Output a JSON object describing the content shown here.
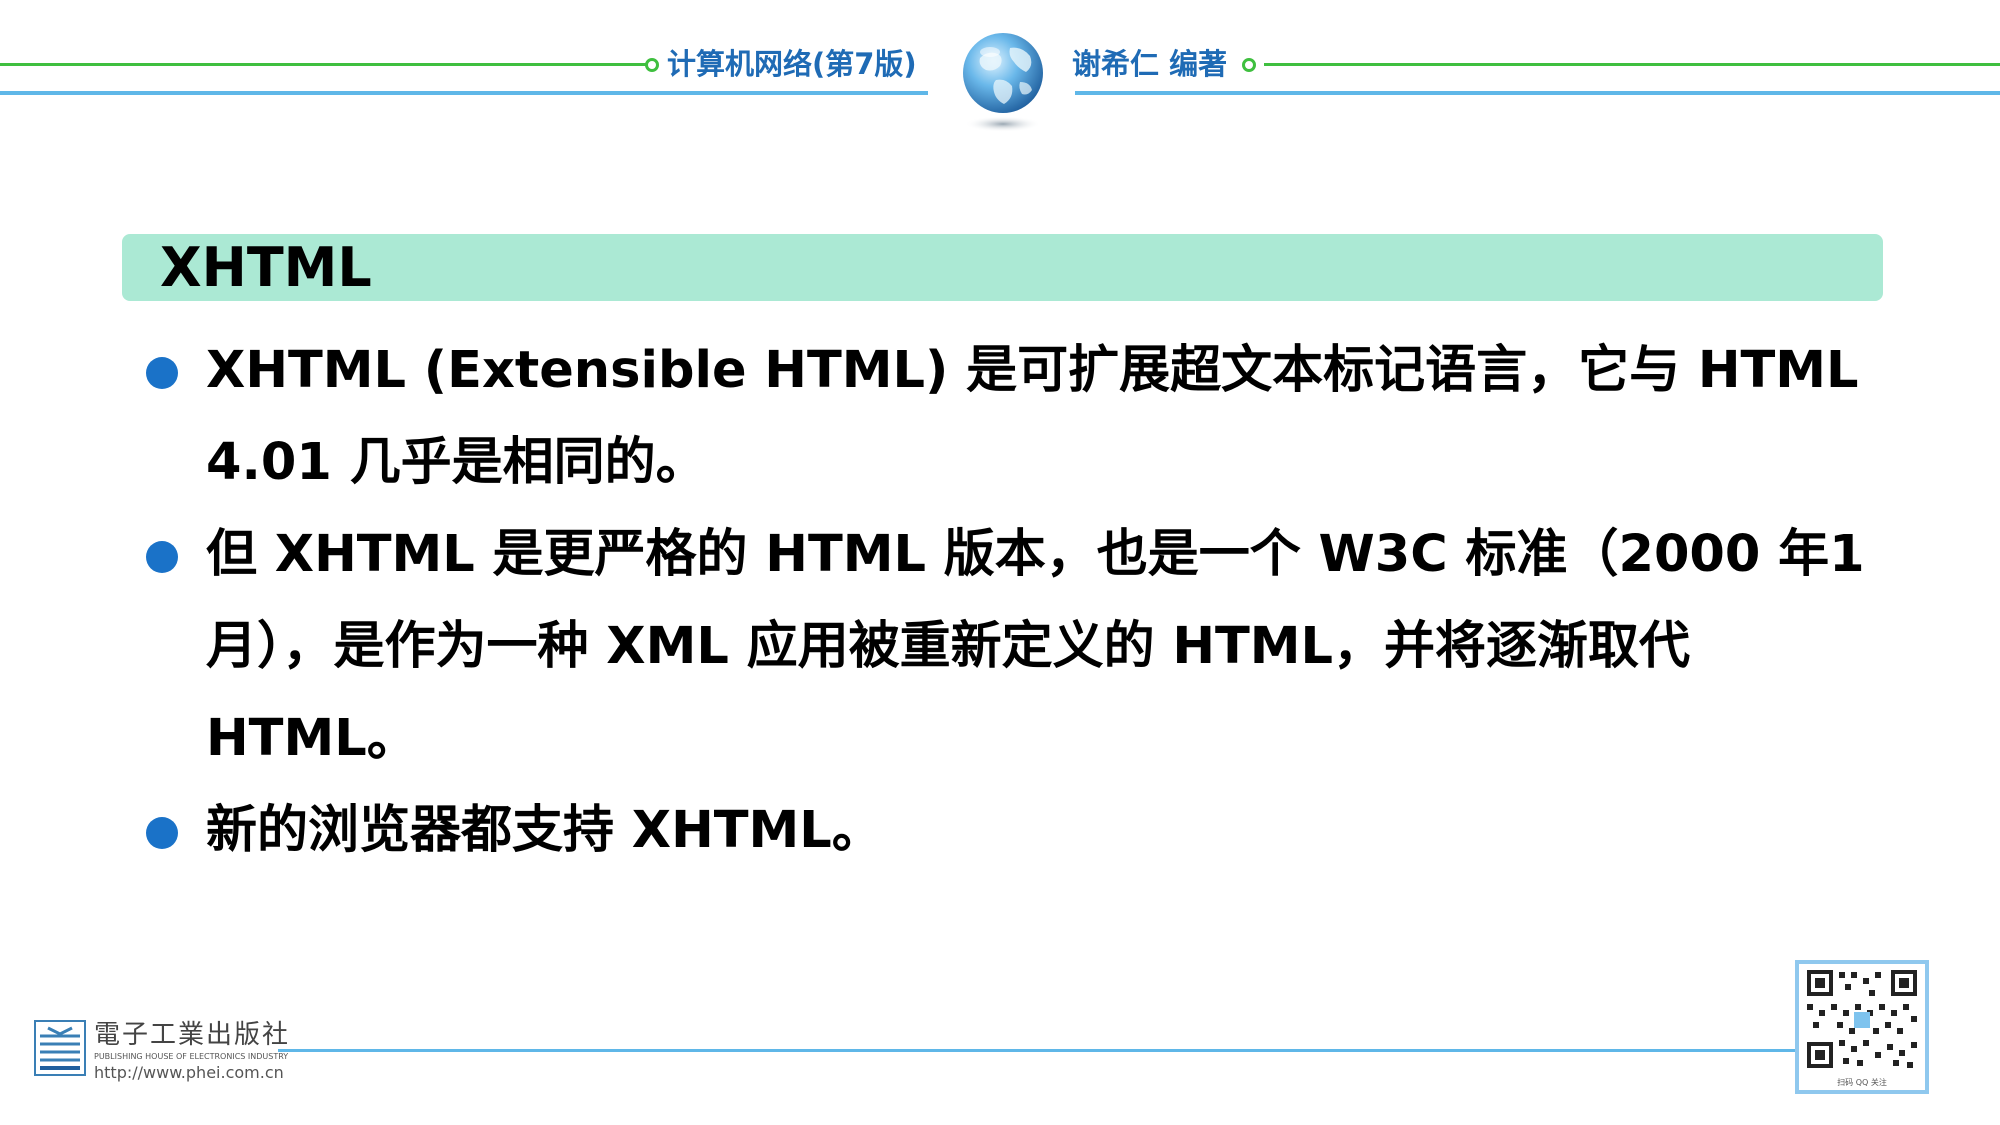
{
  "header": {
    "book_title": "计算机网络(第7版)",
    "author": "谢希仁 编著"
  },
  "slide": {
    "title": "XHTML",
    "bullets": [
      "XHTML (Extensible HTML) 是可扩展超文本标记语言，它与 HTML 4.01 几乎是相同的。",
      "但 XHTML 是更严格的 HTML 版本，也是一个 W3C 标准（2000 年1月），是作为一种 XML 应用被重新定义的 HTML，并将逐渐取代 HTML。",
      "新的浏览器都支持 XHTML。"
    ]
  },
  "footer": {
    "publisher_name": "電子工業出版社",
    "publisher_english": "PUBLISHING HOUSE OF ELECTRONICS INDUSTRY",
    "publisher_url": "http://www.phei.com.cn",
    "qr_caption": "扫码 QQ 关注"
  },
  "colors": {
    "header_green": "#3fbf3f",
    "header_blue": "#5fb7e8",
    "header_text": "#1f6bb5",
    "title_bar": "#abe9d4",
    "bullet_dot": "#1a72c8"
  },
  "icons": [
    "globe-icon",
    "phei-logo-icon",
    "qr-code-icon"
  ]
}
